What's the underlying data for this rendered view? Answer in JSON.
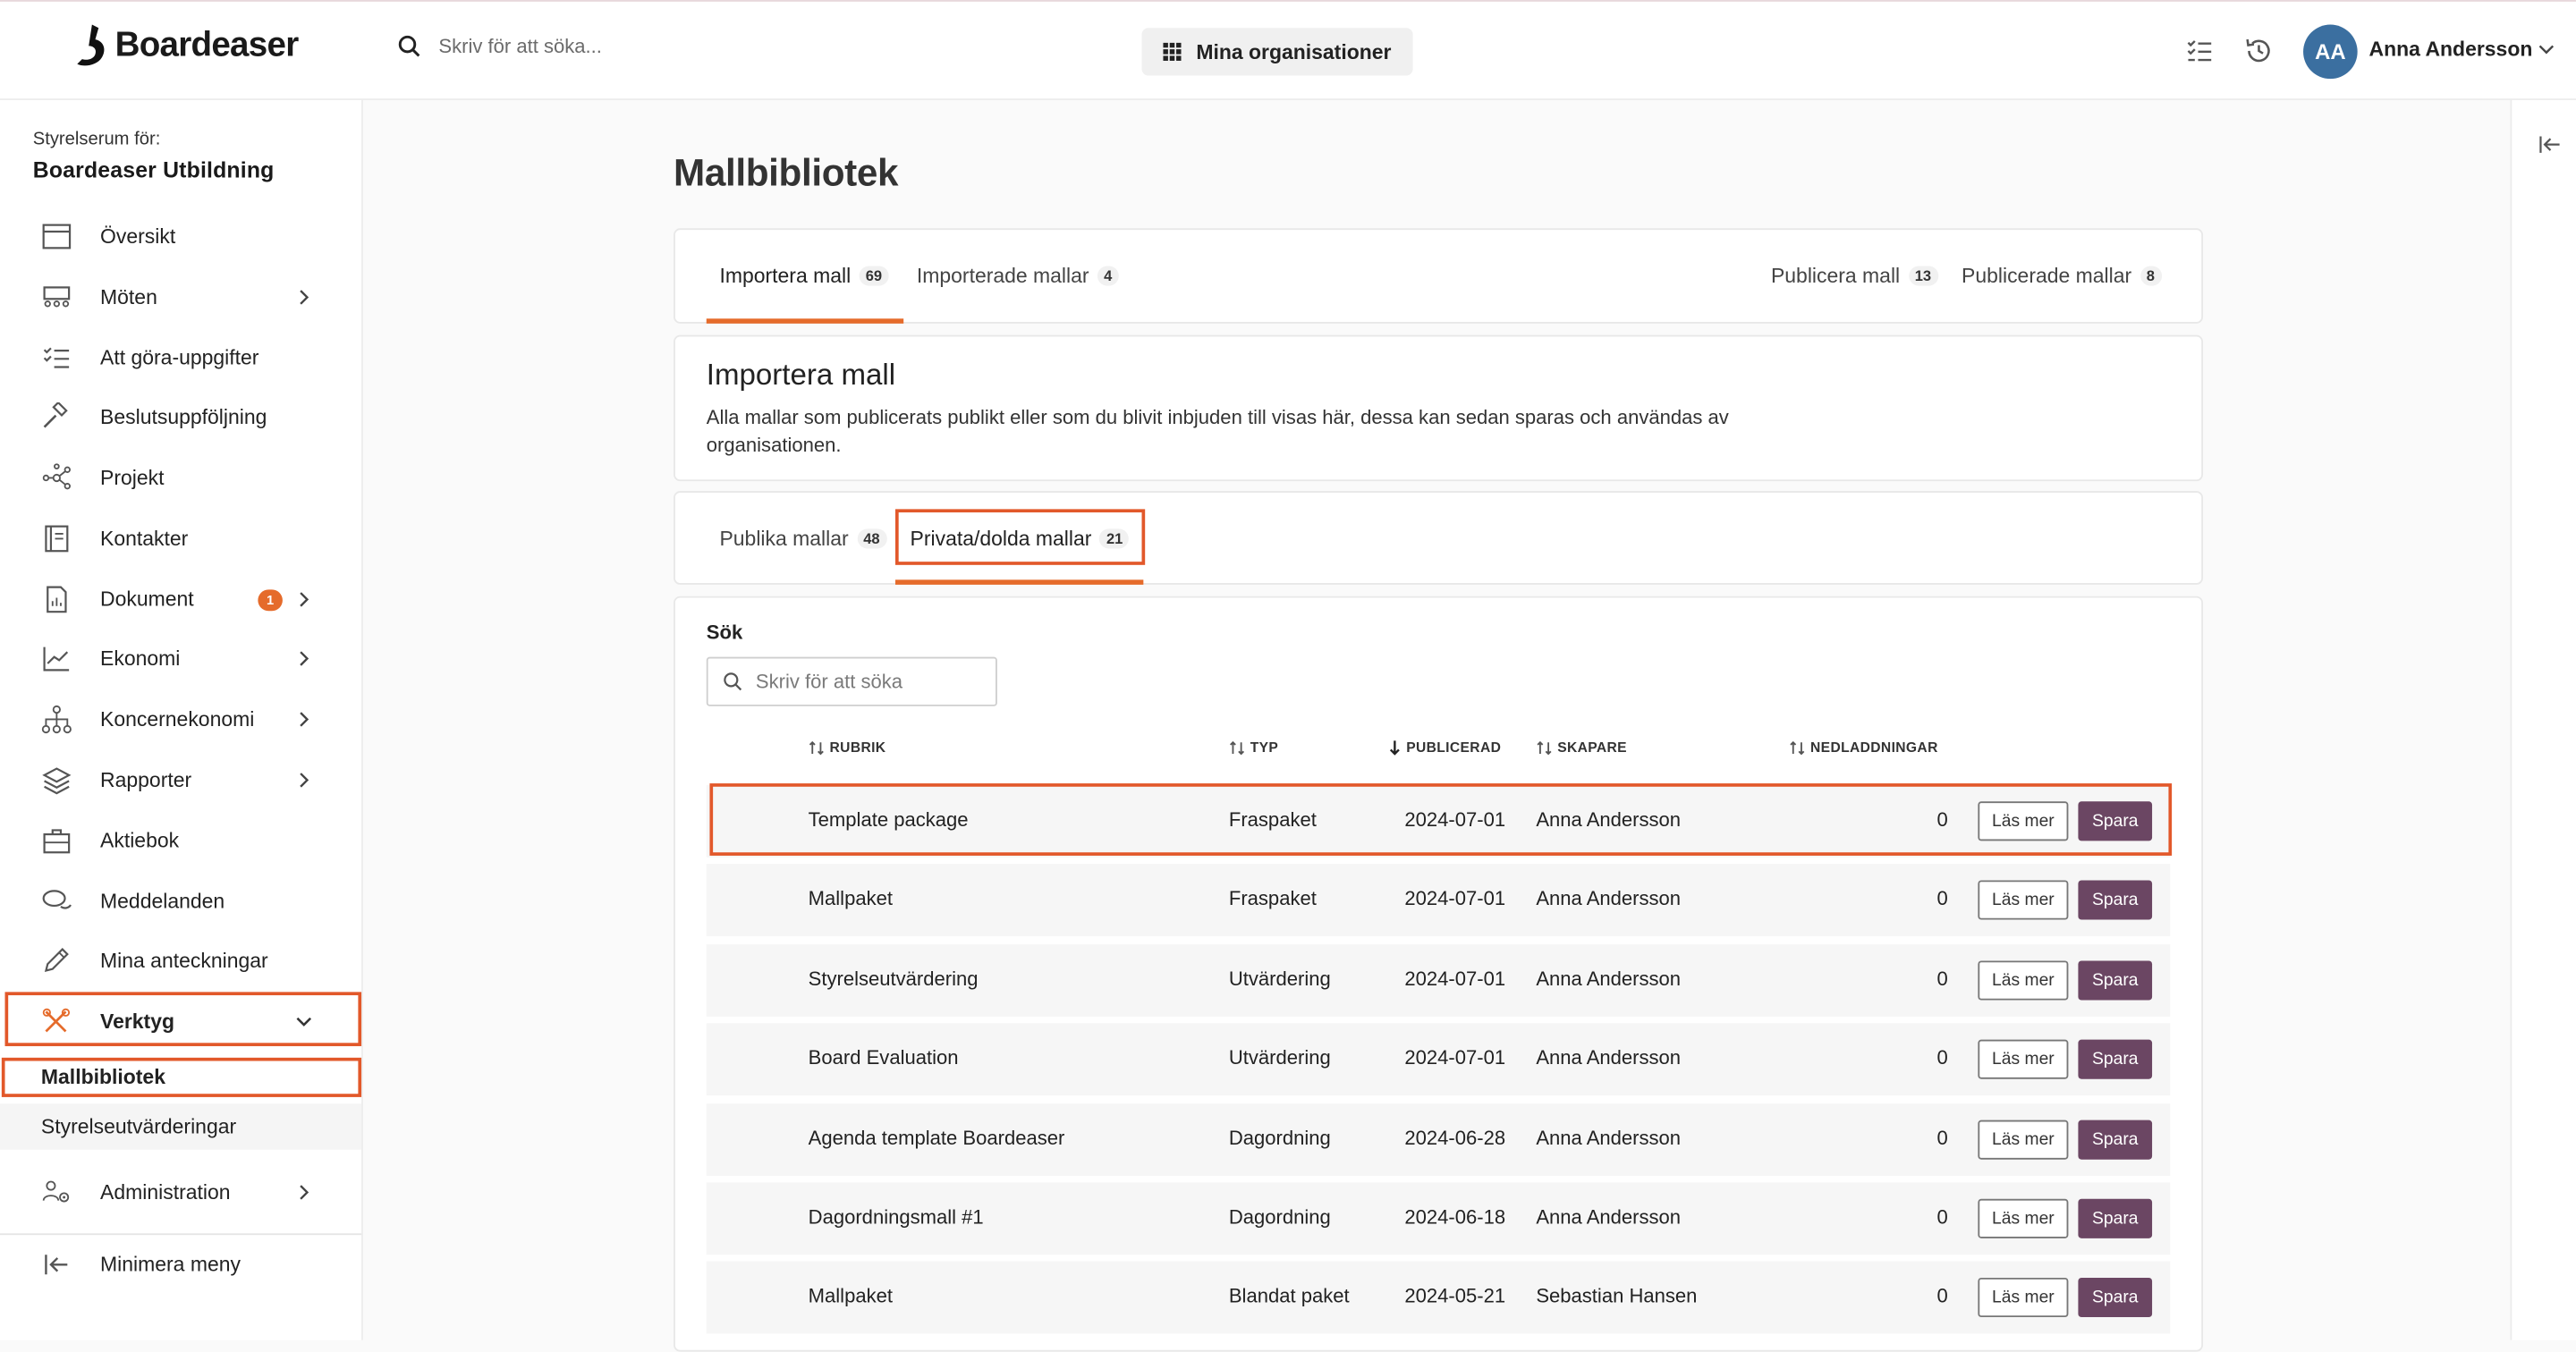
{
  "app": {
    "name": "Boardeaser"
  },
  "topbar": {
    "search_placeholder": "Skriv för att söka...",
    "orgs_button": "Mina organisationer",
    "user_initials": "AA",
    "user_name": "Anna Andersson"
  },
  "sidebar": {
    "for_label": "Styrelserum för:",
    "org_name": "Boardeaser Utbildning",
    "items": [
      {
        "label": "Översikt",
        "icon": "calendar-icon"
      },
      {
        "label": "Möten",
        "icon": "meeting-icon"
      },
      {
        "label": "Att göra-uppgifter",
        "icon": "checklist-icon"
      },
      {
        "label": "Beslutsuppföljning",
        "icon": "gavel-icon"
      },
      {
        "label": "Projekt",
        "icon": "network-icon"
      },
      {
        "label": "Kontakter",
        "icon": "contacts-icon"
      },
      {
        "label": "Dokument",
        "icon": "document-icon",
        "badge": "1"
      },
      {
        "label": "Ekonomi",
        "icon": "chart-line-icon"
      },
      {
        "label": "Koncernekonomi",
        "icon": "hierarchy-icon"
      },
      {
        "label": "Rapporter",
        "icon": "layers-icon"
      },
      {
        "label": "Aktiebok",
        "icon": "briefcase-icon"
      },
      {
        "label": "Meddelanden",
        "icon": "chat-icon"
      },
      {
        "label": "Mina anteckningar",
        "icon": "pencil-icon"
      },
      {
        "label": "Verktyg",
        "icon": "tools-icon"
      },
      {
        "label": "Administration",
        "icon": "users-gear-icon"
      }
    ],
    "sub_items": [
      "Mallbibliotek",
      "Styrelseutvärderingar"
    ],
    "minimize": "Minimera meny"
  },
  "main": {
    "title": "Mallbibliotek",
    "tabs": [
      {
        "label": "Importera mall",
        "count": "69"
      },
      {
        "label": "Importerade mallar",
        "count": "4"
      },
      {
        "label": "Publicera mall",
        "count": "13"
      },
      {
        "label": "Publicerade mallar",
        "count": "8"
      }
    ],
    "import_title": "Importera mall",
    "import_desc": "Alla mallar som publicerats publikt eller som du blivit inbjuden till visas här, dessa kan sedan sparas och användas av organisationen.",
    "sub_tabs": [
      {
        "label": "Publika mallar",
        "count": "48"
      },
      {
        "label": "Privata/dolda mallar",
        "count": "21"
      }
    ],
    "search_label": "Sök",
    "search_placeholder": "Skriv för att söka",
    "columns": [
      "RUBRIK",
      "TYP",
      "PUBLICERAD",
      "SKAPARE",
      "NEDLADDNINGAR"
    ],
    "btn_more": "Läs mer",
    "btn_save": "Spara",
    "rows": [
      {
        "title": "Template package",
        "type": "Fraspaket",
        "published": "2024-07-01",
        "creator": "Anna Andersson",
        "downloads": "0"
      },
      {
        "title": "Mallpaket",
        "type": "Fraspaket",
        "published": "2024-07-01",
        "creator": "Anna Andersson",
        "downloads": "0"
      },
      {
        "title": "Styrelseutvärdering",
        "type": "Utvärdering",
        "published": "2024-07-01",
        "creator": "Anna Andersson",
        "downloads": "0"
      },
      {
        "title": "Board Evaluation",
        "type": "Utvärdering",
        "published": "2024-07-01",
        "creator": "Anna Andersson",
        "downloads": "0"
      },
      {
        "title": "Agenda template Boardeaser",
        "type": "Dagordning",
        "published": "2024-06-28",
        "creator": "Anna Andersson",
        "downloads": "0"
      },
      {
        "title": "Dagordningsmall #1",
        "type": "Dagordning",
        "published": "2024-06-18",
        "creator": "Anna Andersson",
        "downloads": "0"
      },
      {
        "title": "Mallpaket",
        "type": "Blandat paket",
        "published": "2024-05-21",
        "creator": "Sebastian Hansen",
        "downloads": "0"
      }
    ]
  },
  "colors": {
    "accent": "#e56b2b",
    "save_button": "#6b4663",
    "avatar": "#3b6fa0",
    "highlight": "#e2582a"
  }
}
